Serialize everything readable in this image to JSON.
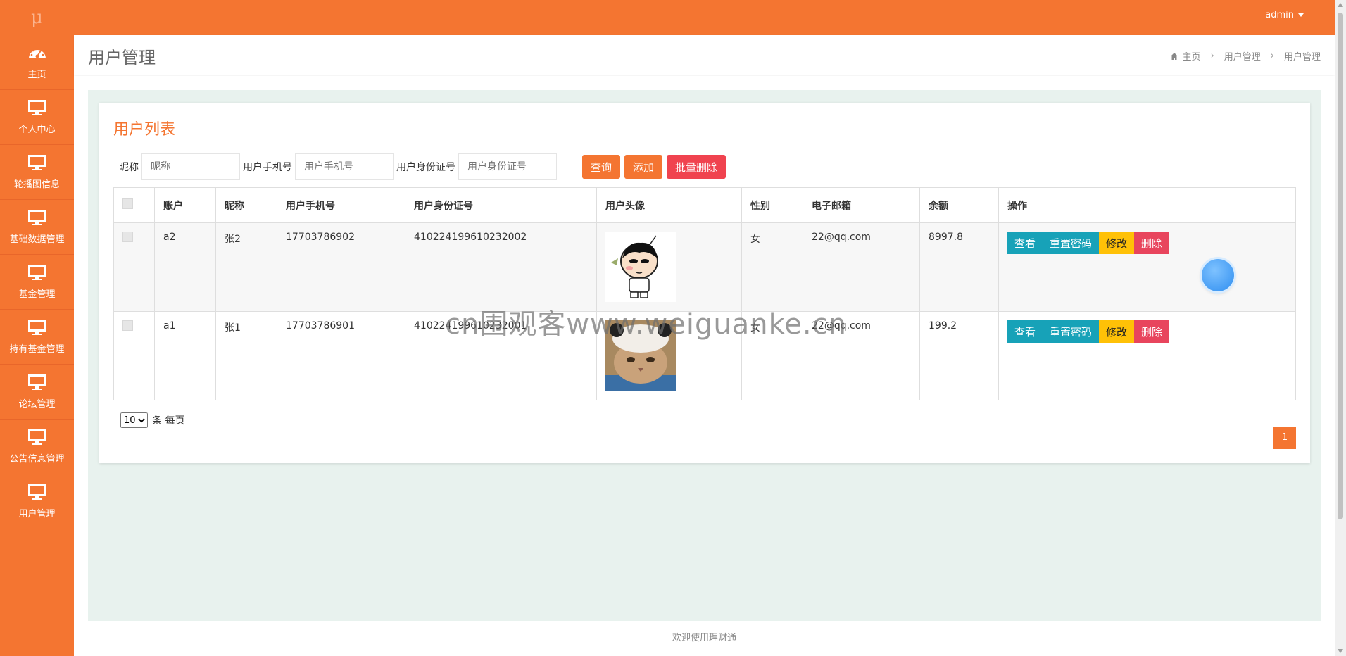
{
  "app": {
    "logo": "μ",
    "user": "admin"
  },
  "sidebar": {
    "items": [
      {
        "label": "主页",
        "icon": "dashboard-icon"
      },
      {
        "label": "个人中心",
        "icon": "monitor-icon"
      },
      {
        "label": "轮播图信息",
        "icon": "monitor-icon"
      },
      {
        "label": "基础数据管理",
        "icon": "monitor-icon"
      },
      {
        "label": "基金管理",
        "icon": "monitor-icon"
      },
      {
        "label": "持有基金管理",
        "icon": "monitor-icon"
      },
      {
        "label": "论坛管理",
        "icon": "monitor-icon"
      },
      {
        "label": "公告信息管理",
        "icon": "monitor-icon"
      },
      {
        "label": "用户管理",
        "icon": "monitor-icon"
      }
    ]
  },
  "header": {
    "title": "用户管理",
    "breadcrumb": [
      "主页",
      "用户管理",
      "用户管理"
    ]
  },
  "card": {
    "title": "用户列表",
    "filters": [
      {
        "label": "昵称",
        "placeholder": "昵称"
      },
      {
        "label": "用户手机号",
        "placeholder": "用户手机号"
      },
      {
        "label": "用户身份证号",
        "placeholder": "用户身份证号"
      }
    ],
    "buttons": {
      "search": "查询",
      "add": "添加",
      "batch_delete": "批量删除"
    }
  },
  "table": {
    "columns": [
      "账户",
      "昵称",
      "用户手机号",
      "用户身份证号",
      "用户头像",
      "性别",
      "电子邮箱",
      "余额",
      "操作"
    ],
    "rows": [
      {
        "account": "a2",
        "nickname": "张2",
        "phone": "17703786902",
        "id_card": "410224199610232002",
        "gender": "女",
        "email": "22@qq.com",
        "balance": "8997.8",
        "avatar": "cartoon-boy-avatar"
      },
      {
        "account": "a1",
        "nickname": "张1",
        "phone": "17703786901",
        "id_card": "410224199610232001",
        "gender": "女",
        "email": "22@qq.com",
        "balance": "199.2",
        "avatar": "cat-avatar"
      }
    ],
    "actions": {
      "view": "查看",
      "reset": "重置密码",
      "edit": "修改",
      "delete": "删除"
    }
  },
  "pagination": {
    "page_size": "10",
    "page_size_suffix": "条 每页",
    "current_page": "1"
  },
  "footer": {
    "text": "欢迎使用理财通"
  },
  "watermark": "cn围观客www.weiguanke.cn",
  "colors": {
    "primary": "#f47531",
    "cyan": "#17a2b8",
    "yellow": "#ffc107",
    "red": "#e8455d"
  }
}
